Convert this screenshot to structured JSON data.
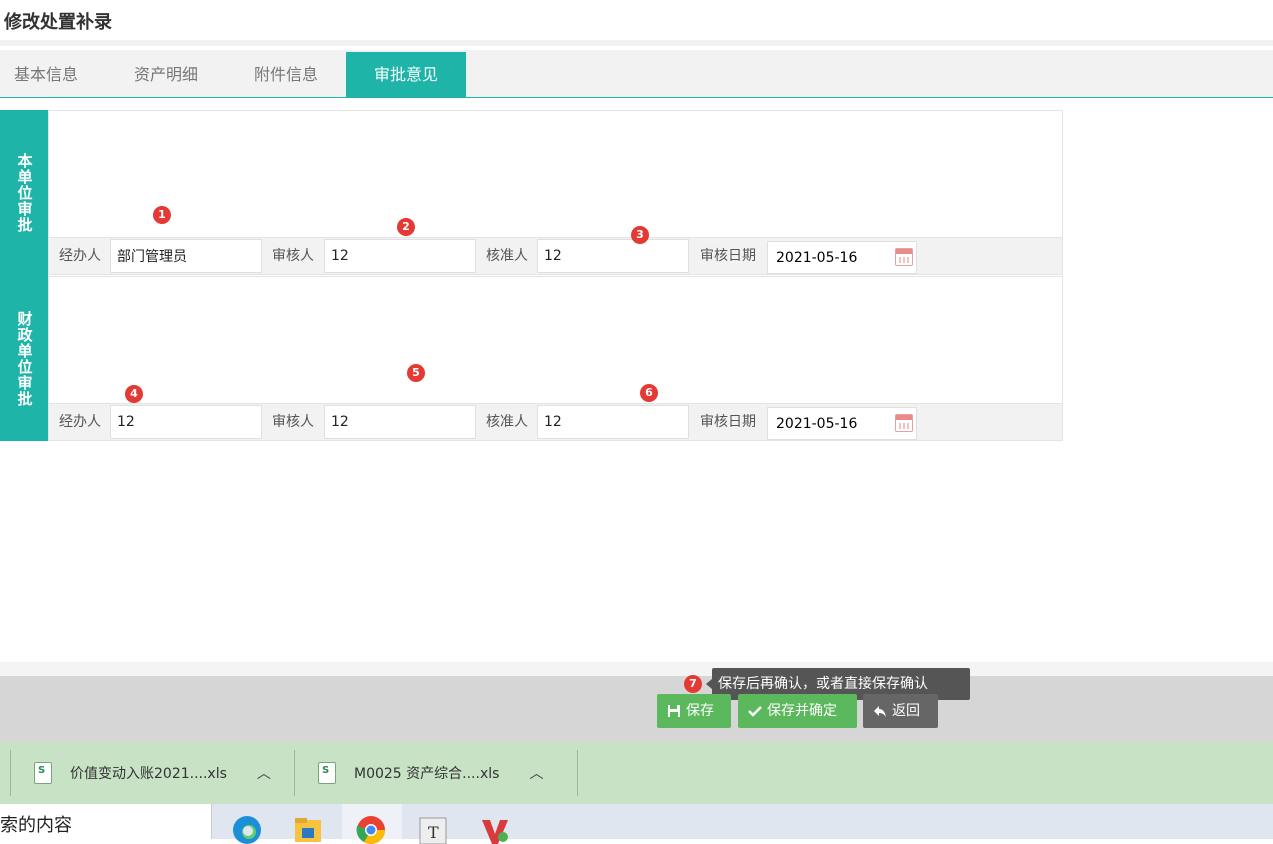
{
  "page": {
    "title": "修改处置补录"
  },
  "tabs": [
    {
      "label": "基本信息",
      "active": false
    },
    {
      "label": "资产明细",
      "active": false
    },
    {
      "label": "附件信息",
      "active": false
    },
    {
      "label": "审批意见",
      "active": true
    }
  ],
  "sections": [
    {
      "label": "本单位审批",
      "opinion": "",
      "handler_label": "经办人",
      "handler_value": "部门管理员",
      "reviewer_label": "审核人",
      "reviewer_value": "12",
      "approver_label": "核准人",
      "approver_value": "12",
      "date_label": "审核日期",
      "date_value": "2021-05-16"
    },
    {
      "label": "财政单位审批",
      "opinion": "",
      "handler_label": "经办人",
      "handler_value": "12",
      "reviewer_label": "审核人",
      "reviewer_value": "12",
      "approver_label": "核准人",
      "approver_value": "12",
      "date_label": "审核日期",
      "date_value": "2021-05-16"
    }
  ],
  "badges": [
    "1",
    "2",
    "3",
    "4",
    "5",
    "6",
    "7"
  ],
  "tooltip": "保存后再确认，或者直接保存确认",
  "buttons": {
    "save": "保存",
    "save_confirm": "保存并确定",
    "back": "返回"
  },
  "downloads": [
    {
      "name": "价值变动入账2021....xls"
    },
    {
      "name": "M0025 资产综合....xls"
    }
  ],
  "taskbar": {
    "search_text": "索的内容"
  },
  "colors": {
    "accent": "#1fb4a8",
    "green": "#5cb85c",
    "badge": "#e53935",
    "download_bar": "#c8e2c6"
  }
}
